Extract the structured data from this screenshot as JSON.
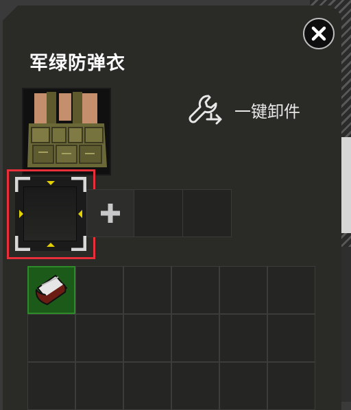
{
  "panel": {
    "title": "军绿防弹衣",
    "unload_label": "一键卸件"
  },
  "icons": {
    "close": "close-x-icon",
    "unload": "wrench-arrow-icon",
    "add_slot": "plus-icon",
    "selected_slot": "empty-slot-bracket-icon",
    "item": "bandage-roll-icon"
  },
  "colors": {
    "selection_outline": "#e8303a",
    "bracket_marker": "#e3d000",
    "occupied_cell": "#1c5a1a"
  },
  "attachment_slots": {
    "selected_index": 0,
    "count": 4,
    "add_index": 1
  },
  "inventory": {
    "rows": 3,
    "cols": 6,
    "occupied": [
      {
        "row": 0,
        "col": 0,
        "item": "bandage-roll-icon"
      }
    ]
  }
}
